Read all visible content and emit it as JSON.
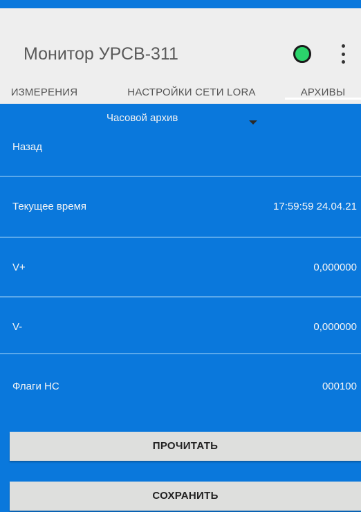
{
  "app": {
    "title": "Монитор УРСВ-311",
    "status_color": "#2bd46b"
  },
  "tabs": [
    {
      "label": "ИЗМЕРЕНИЯ",
      "active": false
    },
    {
      "label": "НАСТРОЙКИ СЕТИ LORA",
      "active": false
    },
    {
      "label": "АРХИВЫ",
      "active": true
    }
  ],
  "archive_select": {
    "selected": "Часовой архив"
  },
  "rows": [
    {
      "label": "Назад",
      "value": ""
    },
    {
      "label": "Текущее время",
      "value": "17:59:59 24.04.21"
    },
    {
      "label": "V+",
      "value": "0,000000"
    },
    {
      "label": "V-",
      "value": "0,000000"
    },
    {
      "label": "Флаги НС",
      "value": "000100"
    }
  ],
  "buttons": {
    "read": "ПРОЧИТАТЬ",
    "save": "СОХРАНИТЬ"
  },
  "colors": {
    "accent": "#0a78dc",
    "button": "#dedfdd"
  }
}
